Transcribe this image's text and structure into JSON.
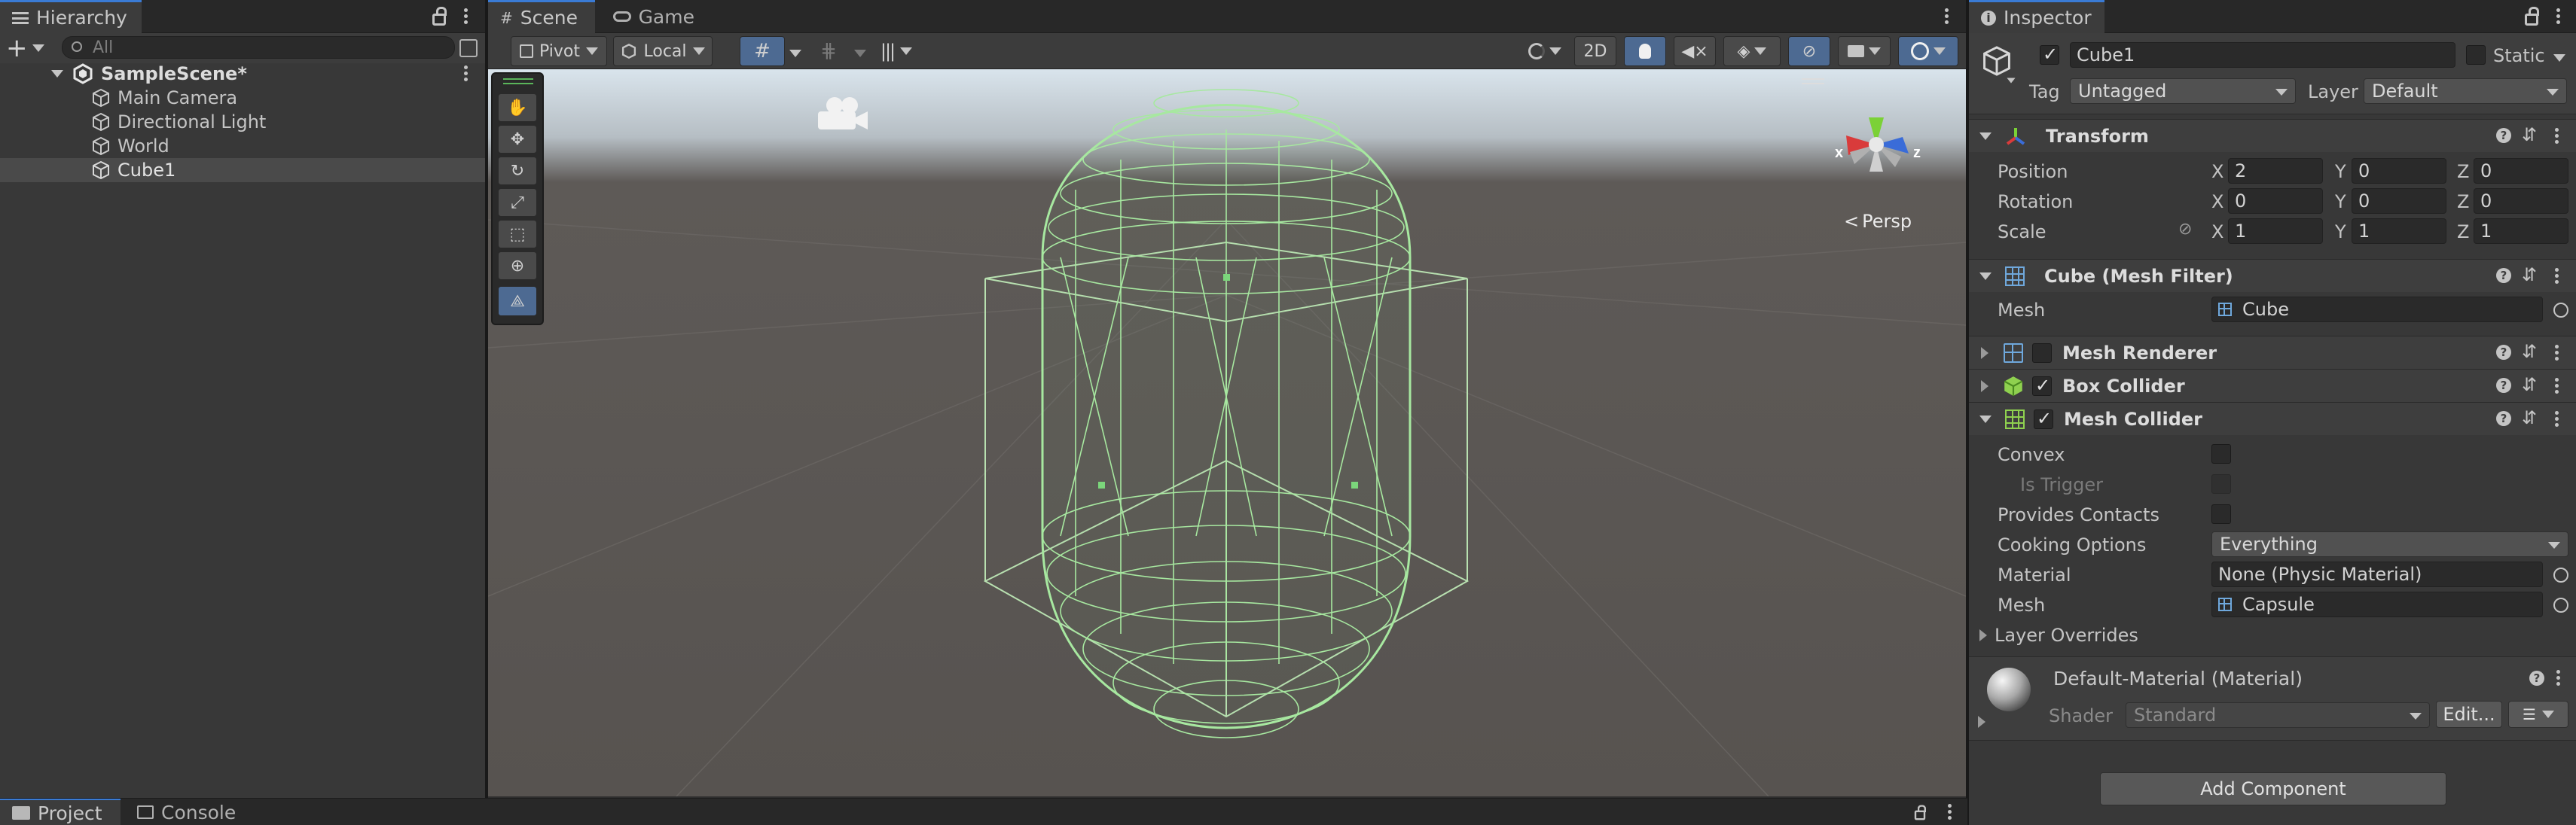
{
  "hierarchy": {
    "tab": "Hierarchy",
    "search_placeholder": "All",
    "scene": "SampleScene*",
    "items": [
      "Main Camera",
      "Directional Light",
      "World",
      "Cube1"
    ]
  },
  "scene_view": {
    "tabs": [
      "Scene",
      "Game"
    ],
    "pivot": "Pivot",
    "local": "Local",
    "toggle_2d": "2D",
    "persp": "Persp",
    "axis_x": "x",
    "axis_z": "z"
  },
  "bottom_tabs": [
    "Project",
    "Console"
  ],
  "inspector": {
    "tab": "Inspector",
    "object_name": "Cube1",
    "static_label": "Static",
    "tag_label": "Tag",
    "tag_value": "Untagged",
    "layer_label": "Layer",
    "layer_value": "Default",
    "transform": {
      "title": "Transform",
      "position_label": "Position",
      "rotation_label": "Rotation",
      "scale_label": "Scale",
      "x": "X",
      "y": "Y",
      "z": "Z",
      "position": [
        "2",
        "0",
        "0"
      ],
      "rotation": [
        "0",
        "0",
        "0"
      ],
      "scale": [
        "1",
        "1",
        "1"
      ]
    },
    "mesh_filter": {
      "title": "Cube (Mesh Filter)",
      "mesh_label": "Mesh",
      "mesh_value": "Cube"
    },
    "mesh_renderer": {
      "title": "Mesh Renderer"
    },
    "box_collider": {
      "title": "Box Collider"
    },
    "mesh_collider": {
      "title": "Mesh Collider",
      "convex_label": "Convex",
      "is_trigger_label": "Is Trigger",
      "provides_contacts_label": "Provides Contacts",
      "cooking_label": "Cooking Options",
      "cooking_value": "Everything",
      "material_label": "Material",
      "material_value": "None (Physic Material)",
      "mesh_label": "Mesh",
      "mesh_value": "Capsule",
      "layer_overrides": "Layer Overrides"
    },
    "material": {
      "title": "Default-Material (Material)",
      "shader_label": "Shader",
      "shader_value": "Standard",
      "edit_label": "Edit..."
    },
    "add_component": "Add Component"
  },
  "colors": {
    "accent": "#3a7bd5",
    "wire": "#9ee09a",
    "panel": "#383838"
  }
}
